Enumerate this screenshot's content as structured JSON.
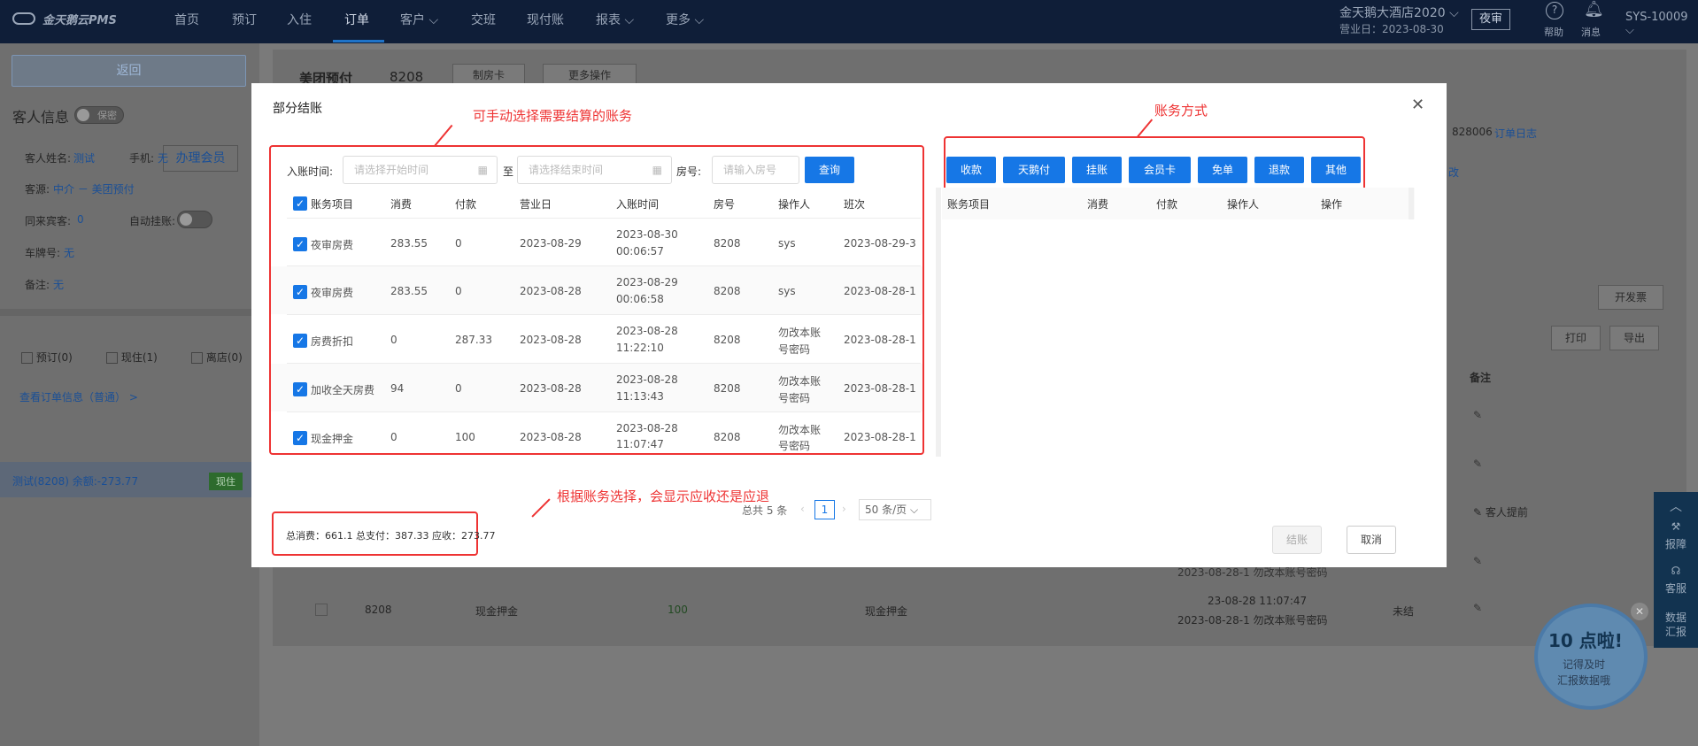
{
  "nav": {
    "brand": "金天鹅云PMS",
    "items": [
      "首页",
      "预订",
      "入住",
      "订单",
      "客户",
      "交班",
      "现付账",
      "报表",
      "更多"
    ],
    "hotel": "金天鹅大酒店2020",
    "business_day": "营业日：2023-08-30",
    "night_audit": "夜审",
    "help": "帮助",
    "messages": "消息",
    "user": "SYS-10009"
  },
  "left": {
    "back": "返回",
    "guest_info": "客人信息",
    "privacy": "保密",
    "member_btn": "办理会员",
    "guest_name_label": "客人姓名:",
    "guest_name": "测试",
    "phone_label": "手机:",
    "phone": "无",
    "source_label": "客源:",
    "source": "中介 － 美团预付",
    "companions_label": "同来宾客:",
    "companions": "0",
    "auto_charge_label": "自动挂账:",
    "plate_label": "车牌号:",
    "plate": "无",
    "remark_label": "备注:",
    "remark": "无",
    "filters": [
      "预订(0)",
      "现住(1)",
      "离店(0)"
    ],
    "view_order": "查看订单信息（普通） >",
    "selected_room": "测试(8208)  余额:-273.77",
    "selected_status": "现住"
  },
  "main": {
    "title": "美团预付",
    "room": "8208",
    "make_card": "制房卡",
    "more_ops": "更多操作",
    "order_no": "828006",
    "order_log": "订单日志",
    "modify": "改",
    "invoice": "开发票",
    "print": "打印",
    "export": "导出",
    "col_remark": "备注",
    "guest_remark": "客人提前",
    "bottom_row": {
      "room": "8208",
      "item": "现金押金",
      "amount": "100",
      "item2": "现金押金",
      "time": "23-08-28 11:07:47",
      "shift": "2023-08-28-1 勿改本账号密码",
      "status": "未结"
    },
    "shift_line_above": "2023-08-28-1 勿改本账号密码"
  },
  "modal": {
    "title": "部分结账",
    "note_left": "可手动选择需要结算的账务",
    "note_right": "账务方式",
    "note_bottom": "根据账务选择，会显示应收还是应退",
    "filter": {
      "time_label": "入账时间:",
      "start_placeholder": "请选择开始时间",
      "to": "至",
      "end_placeholder": "请选择结束时间",
      "room_label": "房号:",
      "room_placeholder": "请输入房号",
      "query": "查询"
    },
    "left_headers": [
      "账务项目",
      "消费",
      "付款",
      "营业日",
      "入账时间",
      "房号",
      "操作人",
      "班次"
    ],
    "rows": [
      {
        "item": "夜审房费",
        "consume": "283.55",
        "pay": "0",
        "bizday": "2023-08-29",
        "time1": "2023-08-30",
        "time2": "00:06:57",
        "room": "8208",
        "op1": "sys",
        "op2": "",
        "shift": "2023-08-29-3"
      },
      {
        "item": "夜审房费",
        "consume": "283.55",
        "pay": "0",
        "bizday": "2023-08-28",
        "time1": "2023-08-29",
        "time2": "00:06:58",
        "room": "8208",
        "op1": "sys",
        "op2": "",
        "shift": "2023-08-28-1"
      },
      {
        "item": "房费折扣",
        "consume": "0",
        "pay": "287.33",
        "bizday": "2023-08-28",
        "time1": "2023-08-28",
        "time2": "11:22:10",
        "room": "8208",
        "op1": "勿改本账",
        "op2": "号密码",
        "shift": "2023-08-28-1"
      },
      {
        "item": "加收全天房费",
        "consume": "94",
        "pay": "0",
        "bizday": "2023-08-28",
        "time1": "2023-08-28",
        "time2": "11:13:43",
        "room": "8208",
        "op1": "勿改本账",
        "op2": "号密码",
        "shift": "2023-08-28-1"
      },
      {
        "item": "现金押金",
        "consume": "0",
        "pay": "100",
        "bizday": "2023-08-28",
        "time1": "2023-08-28",
        "time2": "11:07:47",
        "room": "8208",
        "op1": "勿改本账",
        "op2": "号密码",
        "shift": "2023-08-28-1"
      }
    ],
    "pay_methods": [
      "收款",
      "天鹅付",
      "挂账",
      "会员卡",
      "免单",
      "退款",
      "其他"
    ],
    "right_headers": [
      "账务项目",
      "消费",
      "付款",
      "操作人",
      "操作"
    ],
    "pagination": {
      "total": "总共 5 条",
      "page": "1",
      "per_page": "50 条/页"
    },
    "summary": "总消费：661.1   总支付：387.33   应收：273.77",
    "settle": "结账",
    "cancel": "取消"
  },
  "float": {
    "items": [
      "报障",
      "客服",
      "数据汇报"
    ],
    "promo_title": "10 点啦!",
    "promo_line1": "记得及时",
    "promo_line2": "汇报数据哦"
  }
}
